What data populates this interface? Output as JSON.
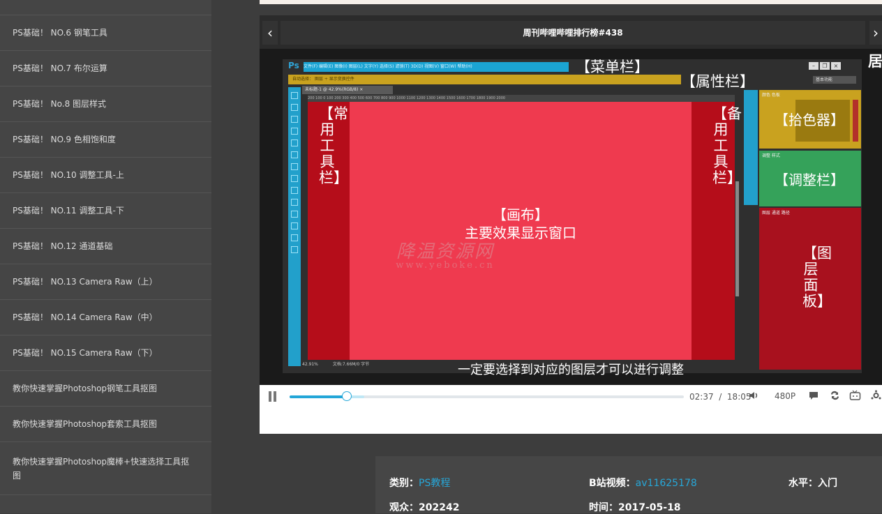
{
  "sidebar": {
    "items": [
      {
        "label": "PS基础！ NO.6 钢笔工具"
      },
      {
        "label": "PS基础！ NO.7 布尔运算"
      },
      {
        "label": "PS基础！ No.8 图层样式"
      },
      {
        "label": "PS基础！ NO.9 色相饱和度"
      },
      {
        "label": "PS基础！ NO.10 调整工具-上"
      },
      {
        "label": "PS基础！ NO.11 调整工具-下"
      },
      {
        "label": "PS基础！ NO.12 通道基础"
      },
      {
        "label": "PS基础！ NO.13 Camera Raw（上）"
      },
      {
        "label": "PS基础！ NO.14 Camera Raw（中）"
      },
      {
        "label": "PS基础！ NO.15 Camera Raw（下）"
      },
      {
        "label": "教你快速掌握Photoshop钢笔工具抠图"
      },
      {
        "label": "教你快速掌握Photoshop套索工具抠图"
      },
      {
        "label": "教你快速掌握Photoshop魔棒+快速选择工具抠图"
      }
    ]
  },
  "player": {
    "title": "周刊哔哩哔哩排行榜#438",
    "prev_icon": "‹",
    "next_icon": "›",
    "edge_char": "居",
    "subtitle": "一定要选择到对应的图层才可以进行调整",
    "watermark_logo": "降温资源网",
    "watermark_url": "www.yeboke.cn",
    "ps": {
      "logo": "Ps",
      "menu_items": "文件(F)  编辑(E)  图像(I)  图层(L)  文字(Y)  选择(S)  滤镜(T)  3D(D)  视图(V)  窗口(W)  帮助(H)",
      "options_text": "自动选择：  图层  ÷   显示变换控件",
      "preset": "基本功能",
      "doc_tab": "未标题-1 @ 42.9%(RGB/8)  ×",
      "ruler": "200  100  0  100  200  300  400  500  600  700  800  900  1000  1100  1200  1300  1400  1500  1600  1700  1800  1900  2000",
      "status_zoom": "42.91%",
      "status_doc": "文档:7.66M/0 字节",
      "callout_menu": "【菜单栏】",
      "callout_options": "【属性栏】",
      "callout_tools": "【常用工具栏】",
      "callout_alt_tools": "【备用工具栏】",
      "callout_canvas": "【画布】",
      "callout_canvas_sub": "主要效果显示窗口",
      "callout_picker": "【拾色器】",
      "callout_adjust": "【调整栏】",
      "callout_layers": "【图层面板】",
      "panel_color_tab": "颜色  色板",
      "panel_adjust_tab": "调整  样式",
      "panel_layers_tab": "图层  通道  路径"
    },
    "controls": {
      "current_time": "02:37",
      "total_time": "18:05",
      "progress": 0.1447,
      "buffered": 0.189,
      "quality": "480P"
    }
  },
  "info": {
    "category_label": "类别：",
    "category_value": "PS教程",
    "bilibili_label": "B站视频：",
    "bilibili_value": "av11625178",
    "level_label": "水平：",
    "level_value": "入门",
    "views_label": "观众：",
    "views_value": "202242",
    "date_label": "时间：",
    "date_value": "2017-05-18"
  },
  "colors": {
    "accent": "#23a6d8",
    "ps_blue": "#1ba4d3",
    "ps_gold": "#c9a21f",
    "ps_green": "#35a25a",
    "ps_red": "#ef3a4f"
  }
}
